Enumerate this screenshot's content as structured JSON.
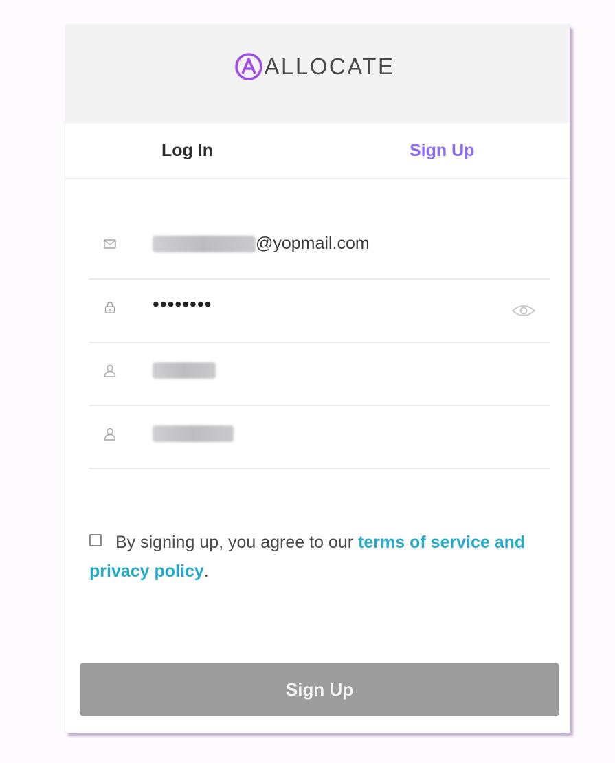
{
  "brand": {
    "name": "ALLOCATE",
    "accent": "#a14ce8"
  },
  "tabs": {
    "login_label": "Log In",
    "signup_label": "Sign Up",
    "active": "signup"
  },
  "form": {
    "email": {
      "icon": "envelope-icon",
      "value_suffix": "@yopmail.com"
    },
    "password": {
      "icon": "lock-icon",
      "value": "••••••••",
      "toggle_icon": "eye-icon"
    },
    "first_name": {
      "icon": "user-icon"
    },
    "last_name": {
      "icon": "user-icon"
    }
  },
  "terms": {
    "prefix": "By signing up, you agree to our ",
    "link": "terms of service and privacy policy",
    "suffix": ".",
    "checked": false
  },
  "submit": {
    "label": "Sign Up",
    "color": "#9c9c9d"
  },
  "colors": {
    "tab_active": "#8c6cf0",
    "link": "#25aac9"
  }
}
